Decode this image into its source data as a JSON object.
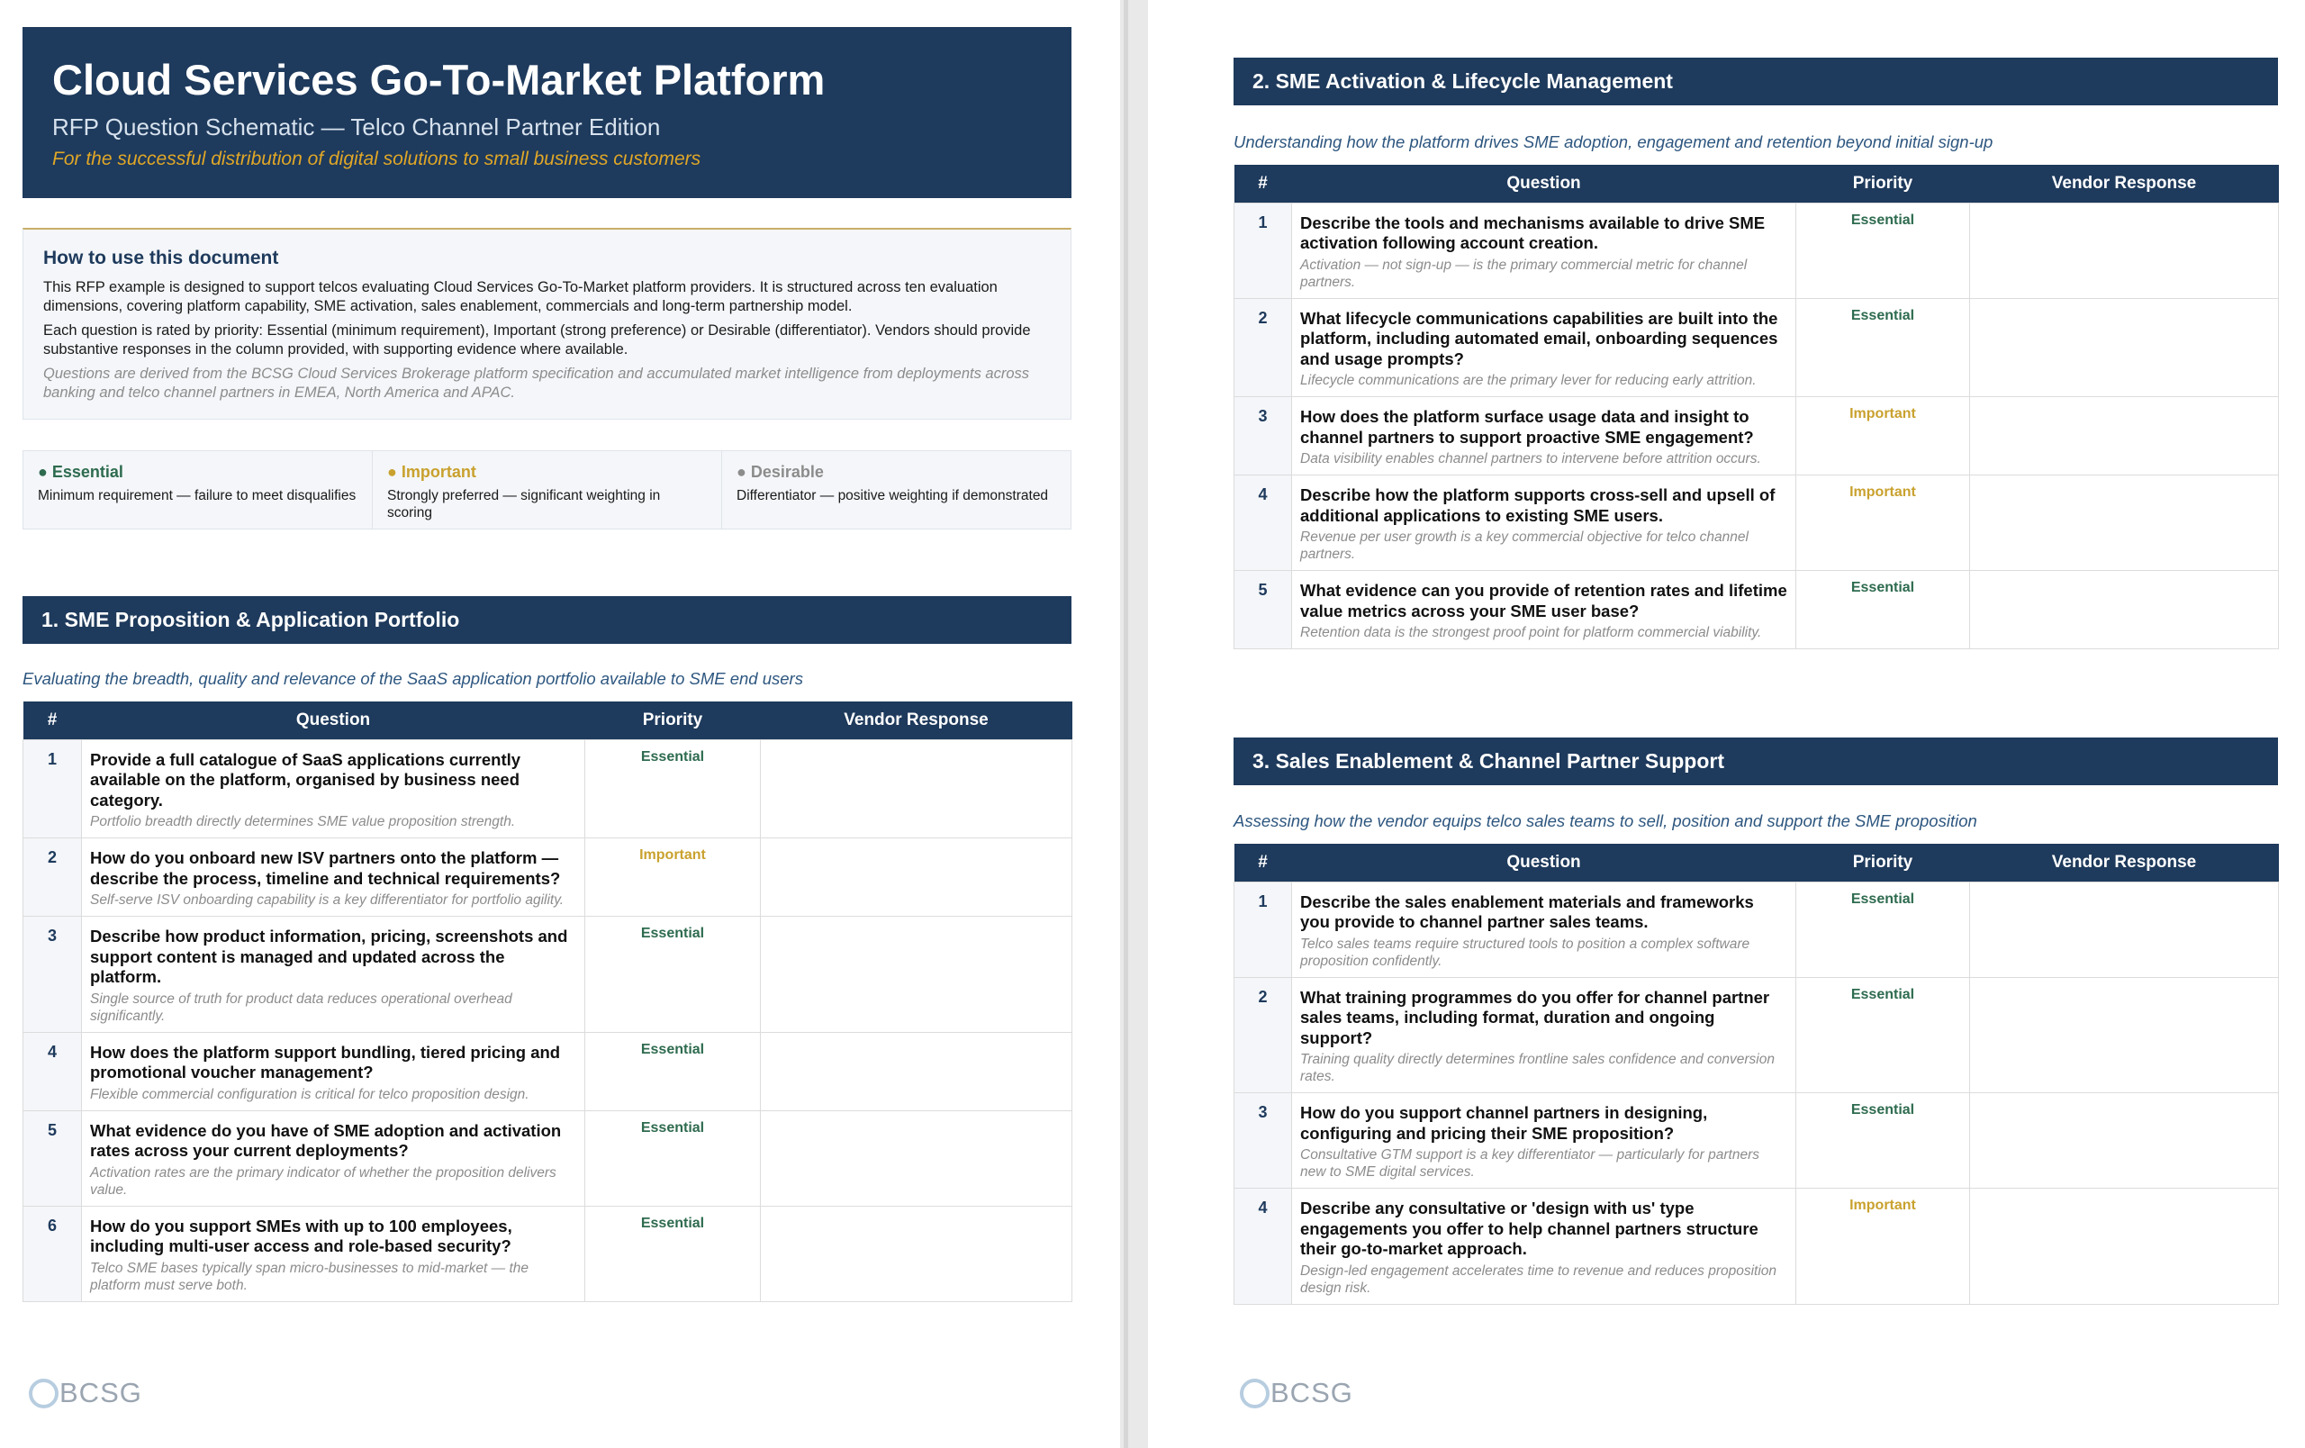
{
  "colors": {
    "navy": "#1e3a5c",
    "gold": "#e0a727",
    "essential": "#2e6b4f",
    "important": "#c9a12e",
    "desirable": "#8c8c8c"
  },
  "header": {
    "title": "Cloud Services Go-To-Market Platform",
    "subtitle": "RFP Question Schematic — Telco Channel Partner Edition",
    "tagline": "For the successful distribution of digital solutions to small business customers"
  },
  "howto": {
    "title": "How to use this document",
    "p1": "This RFP example is designed to support telcos evaluating Cloud Services Go-To-Market platform providers. It is structured across ten evaluation dimensions, covering platform capability, SME activation, sales enablement, commercials and long-term partnership model.",
    "p2": "Each question is rated by priority: Essential (minimum requirement), Important (strong preference) or Desirable (differentiator). Vendors should provide substantive responses in the column provided, with supporting evidence where available.",
    "p3": "Questions are derived from the BCSG Cloud Services Brokerage platform specification and accumulated market intelligence from deployments across banking and telco channel partners in EMEA, North America and APAC."
  },
  "legend": [
    {
      "label": "● Essential",
      "desc": "Minimum requirement — failure to meet disqualifies",
      "color": "#2e6b4f"
    },
    {
      "label": "● Important",
      "desc": "Strongly preferred — significant weighting in scoring",
      "color": "#c9a12e"
    },
    {
      "label": "● Desirable",
      "desc": "Differentiator — positive weighting if demonstrated",
      "color": "#8c8c8c"
    }
  ],
  "columns": {
    "num": "#",
    "question": "Question",
    "priority": "Priority",
    "response": "Vendor Response"
  },
  "sections": [
    {
      "title": "1. SME Proposition & Application Portfolio",
      "intro": "Evaluating the breadth, quality and relevance of the SaaS application portfolio available to SME end users",
      "rows": [
        {
          "num": "1",
          "q": "Provide a full catalogue of SaaS applications currently available on the platform, organised by business need category.",
          "note": "Portfolio breadth directly determines SME value proposition strength.",
          "priority": "Essential"
        },
        {
          "num": "2",
          "q": "How do you onboard new ISV partners onto the platform — describe the process, timeline and technical requirements?",
          "note": "Self-serve ISV onboarding capability is a key differentiator for portfolio agility.",
          "priority": "Important"
        },
        {
          "num": "3",
          "q": "Describe how product information, pricing, screenshots and support content is managed and updated across the platform.",
          "note": "Single source of truth for product data reduces operational overhead significantly.",
          "priority": "Essential"
        },
        {
          "num": "4",
          "q": "How does the platform support bundling, tiered pricing and promotional voucher management?",
          "note": "Flexible commercial configuration is critical for telco proposition design.",
          "priority": "Essential"
        },
        {
          "num": "5",
          "q": "What evidence do you have of SME adoption and activation rates across your current deployments?",
          "note": "Activation rates are the primary indicator of whether the proposition delivers value.",
          "priority": "Essential"
        },
        {
          "num": "6",
          "q": "How do you support SMEs with up to 100 employees, including multi-user access and role-based security?",
          "note": "Telco SME bases typically span micro-businesses to mid-market — the platform must serve both.",
          "priority": "Essential"
        }
      ]
    },
    {
      "title": "2. SME Activation & Lifecycle Management",
      "intro": "Understanding how the platform drives SME adoption, engagement and retention beyond initial sign-up",
      "rows": [
        {
          "num": "1",
          "q": "Describe the tools and mechanisms available to drive SME activation following account creation.",
          "note": "Activation — not sign-up — is the primary commercial metric for channel partners.",
          "priority": "Essential"
        },
        {
          "num": "2",
          "q": "What lifecycle communications capabilities are built into the platform, including automated email, onboarding sequences and usage prompts?",
          "note": "Lifecycle communications are the primary lever for reducing early attrition.",
          "priority": "Essential"
        },
        {
          "num": "3",
          "q": "How does the platform surface usage data and insight to channel partners to support proactive SME engagement?",
          "note": "Data visibility enables channel partners to intervene before attrition occurs.",
          "priority": "Important"
        },
        {
          "num": "4",
          "q": "Describe how the platform supports cross-sell and upsell of additional applications to existing SME users.",
          "note": "Revenue per user growth is a key commercial objective for telco channel partners.",
          "priority": "Important"
        },
        {
          "num": "5",
          "q": "What evidence can you provide of retention rates and lifetime value metrics across your SME user base?",
          "note": "Retention data is the strongest proof point for platform commercial viability.",
          "priority": "Essential"
        }
      ]
    },
    {
      "title": "3. Sales Enablement & Channel Partner Support",
      "intro": "Assessing how the vendor equips telco sales teams to sell, position and support the SME proposition",
      "rows": [
        {
          "num": "1",
          "q": "Describe the sales enablement materials and frameworks you provide to channel partner sales teams.",
          "note": "Telco sales teams require structured tools to position a complex software proposition confidently.",
          "priority": "Essential"
        },
        {
          "num": "2",
          "q": "What training programmes do you offer for channel partner sales teams, including format, duration and ongoing support?",
          "note": "Training quality directly determines frontline sales confidence and conversion rates.",
          "priority": "Essential"
        },
        {
          "num": "3",
          "q": "How do you support channel partners in designing, configuring and pricing their SME proposition?",
          "note": "Consultative GTM support is a key differentiator — particularly for partners new to SME digital services.",
          "priority": "Essential"
        },
        {
          "num": "4",
          "q": "Describe any consultative or 'design with us' type engagements you offer to help channel partners structure their go-to-market approach.",
          "note": "Design-led engagement accelerates time to revenue and reduces proposition design risk.",
          "priority": "Important"
        }
      ]
    }
  ],
  "logo": {
    "text": "BCSG"
  }
}
